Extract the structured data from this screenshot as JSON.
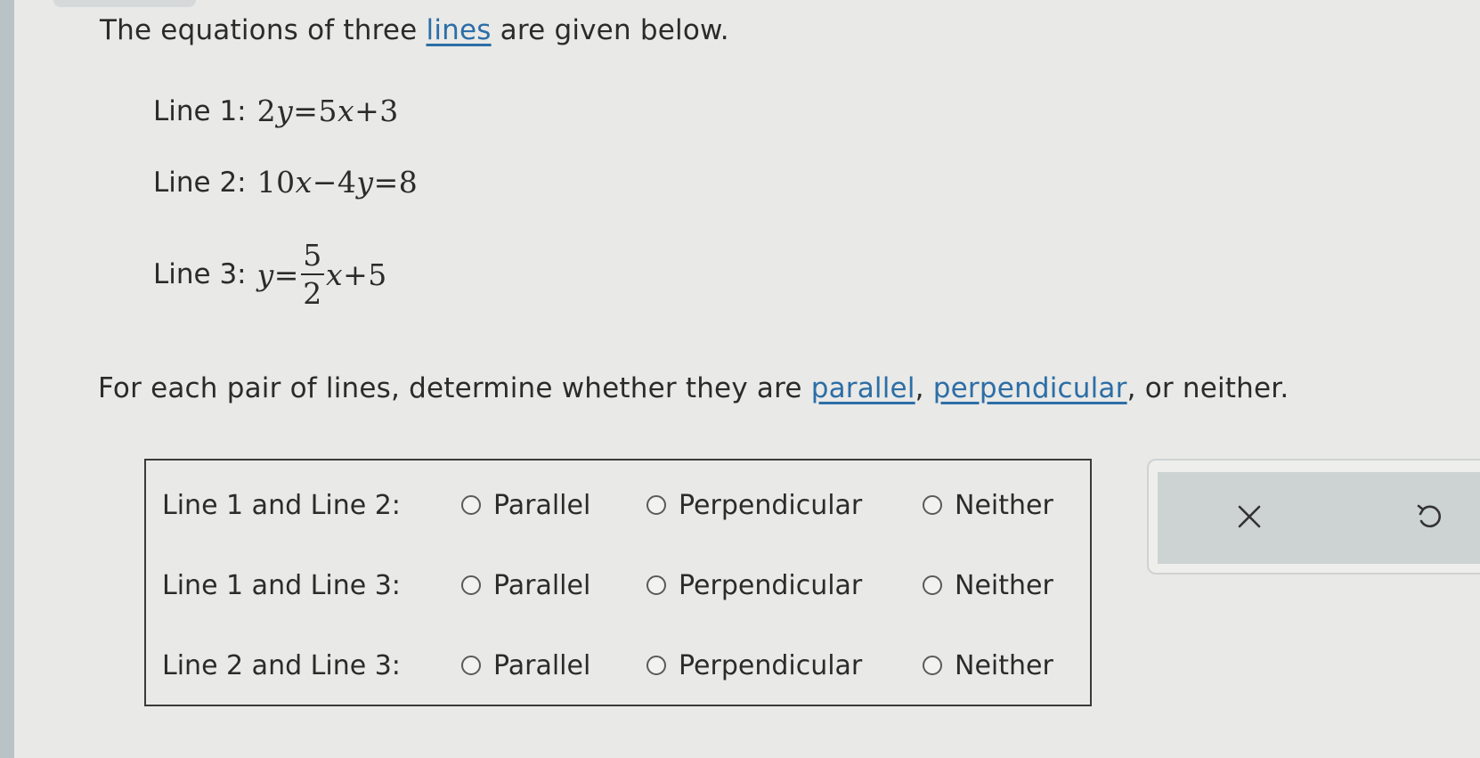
{
  "intro": {
    "before": "The equations of three ",
    "link": "lines",
    "after": " are given below."
  },
  "equations": [
    {
      "label": "Line 1:",
      "lhs": "2y",
      "rhs": "5x+3"
    },
    {
      "label": "Line 2:",
      "lhs": "10x−4y",
      "rhs": "8"
    },
    {
      "label": "Line 3:",
      "lhs": "y",
      "frac_num": "5",
      "frac_den": "2",
      "rhs_tail": "x+5"
    }
  ],
  "instruction": {
    "before": "For each pair of lines, determine whether they are ",
    "link1": "parallel",
    "sep": ", ",
    "link2": "perpendicular",
    "after": ", or neither."
  },
  "pairs": [
    {
      "label": "Line 1 and Line 2:"
    },
    {
      "label": "Line 1 and Line 3:"
    },
    {
      "label": "Line 2 and Line 3:"
    }
  ],
  "options": {
    "parallel": "Parallel",
    "perpendicular": "Perpendicular",
    "neither": "Neither"
  },
  "tools": {
    "clear_icon": "close-icon",
    "undo_icon": "undo-icon"
  }
}
